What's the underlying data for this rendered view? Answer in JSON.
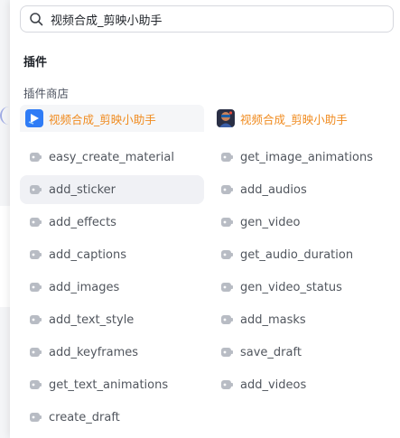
{
  "search": {
    "value": "视频合成_剪映小助手"
  },
  "section_title": "插件",
  "sub_title": "插件商店",
  "tabs": [
    {
      "label": "视频合成_剪映小助手",
      "active": true,
      "logo": "play-logo-icon"
    },
    {
      "label": "视频合成_剪映小助手",
      "active": false,
      "logo": "avatar-logo-icon"
    }
  ],
  "left_tools": [
    "easy_create_material",
    "add_sticker",
    "add_effects",
    "add_captions",
    "add_images",
    "add_text_style",
    "add_keyframes",
    "get_text_animations",
    "create_draft"
  ],
  "right_tools": [
    "get_image_animations",
    "add_audios",
    "gen_video",
    "get_audio_duration",
    "gen_video_status",
    "add_masks",
    "save_draft",
    "add_videos"
  ],
  "highlighted_tool": "add_sticker",
  "colors": {
    "accent": "#f08b1f",
    "text": "#51565e",
    "icon": "#b8bcc4"
  }
}
